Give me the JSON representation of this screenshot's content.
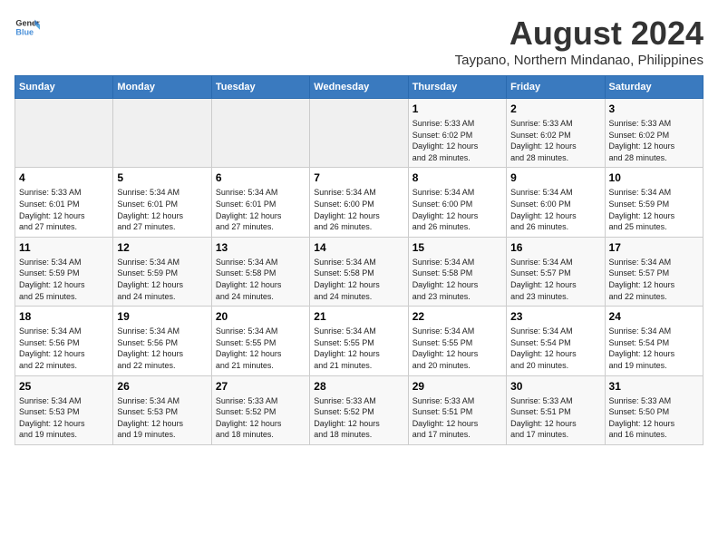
{
  "logo": {
    "general": "General",
    "blue": "Blue"
  },
  "title": "August 2024",
  "subtitle": "Taypano, Northern Mindanao, Philippines",
  "days_of_week": [
    "Sunday",
    "Monday",
    "Tuesday",
    "Wednesday",
    "Thursday",
    "Friday",
    "Saturday"
  ],
  "weeks": [
    [
      {
        "day": "",
        "info": ""
      },
      {
        "day": "",
        "info": ""
      },
      {
        "day": "",
        "info": ""
      },
      {
        "day": "",
        "info": ""
      },
      {
        "day": "1",
        "info": "Sunrise: 5:33 AM\nSunset: 6:02 PM\nDaylight: 12 hours\nand 28 minutes."
      },
      {
        "day": "2",
        "info": "Sunrise: 5:33 AM\nSunset: 6:02 PM\nDaylight: 12 hours\nand 28 minutes."
      },
      {
        "day": "3",
        "info": "Sunrise: 5:33 AM\nSunset: 6:02 PM\nDaylight: 12 hours\nand 28 minutes."
      }
    ],
    [
      {
        "day": "4",
        "info": "Sunrise: 5:33 AM\nSunset: 6:01 PM\nDaylight: 12 hours\nand 27 minutes."
      },
      {
        "day": "5",
        "info": "Sunrise: 5:34 AM\nSunset: 6:01 PM\nDaylight: 12 hours\nand 27 minutes."
      },
      {
        "day": "6",
        "info": "Sunrise: 5:34 AM\nSunset: 6:01 PM\nDaylight: 12 hours\nand 27 minutes."
      },
      {
        "day": "7",
        "info": "Sunrise: 5:34 AM\nSunset: 6:00 PM\nDaylight: 12 hours\nand 26 minutes."
      },
      {
        "day": "8",
        "info": "Sunrise: 5:34 AM\nSunset: 6:00 PM\nDaylight: 12 hours\nand 26 minutes."
      },
      {
        "day": "9",
        "info": "Sunrise: 5:34 AM\nSunset: 6:00 PM\nDaylight: 12 hours\nand 26 minutes."
      },
      {
        "day": "10",
        "info": "Sunrise: 5:34 AM\nSunset: 5:59 PM\nDaylight: 12 hours\nand 25 minutes."
      }
    ],
    [
      {
        "day": "11",
        "info": "Sunrise: 5:34 AM\nSunset: 5:59 PM\nDaylight: 12 hours\nand 25 minutes."
      },
      {
        "day": "12",
        "info": "Sunrise: 5:34 AM\nSunset: 5:59 PM\nDaylight: 12 hours\nand 24 minutes."
      },
      {
        "day": "13",
        "info": "Sunrise: 5:34 AM\nSunset: 5:58 PM\nDaylight: 12 hours\nand 24 minutes."
      },
      {
        "day": "14",
        "info": "Sunrise: 5:34 AM\nSunset: 5:58 PM\nDaylight: 12 hours\nand 24 minutes."
      },
      {
        "day": "15",
        "info": "Sunrise: 5:34 AM\nSunset: 5:58 PM\nDaylight: 12 hours\nand 23 minutes."
      },
      {
        "day": "16",
        "info": "Sunrise: 5:34 AM\nSunset: 5:57 PM\nDaylight: 12 hours\nand 23 minutes."
      },
      {
        "day": "17",
        "info": "Sunrise: 5:34 AM\nSunset: 5:57 PM\nDaylight: 12 hours\nand 22 minutes."
      }
    ],
    [
      {
        "day": "18",
        "info": "Sunrise: 5:34 AM\nSunset: 5:56 PM\nDaylight: 12 hours\nand 22 minutes."
      },
      {
        "day": "19",
        "info": "Sunrise: 5:34 AM\nSunset: 5:56 PM\nDaylight: 12 hours\nand 22 minutes."
      },
      {
        "day": "20",
        "info": "Sunrise: 5:34 AM\nSunset: 5:55 PM\nDaylight: 12 hours\nand 21 minutes."
      },
      {
        "day": "21",
        "info": "Sunrise: 5:34 AM\nSunset: 5:55 PM\nDaylight: 12 hours\nand 21 minutes."
      },
      {
        "day": "22",
        "info": "Sunrise: 5:34 AM\nSunset: 5:55 PM\nDaylight: 12 hours\nand 20 minutes."
      },
      {
        "day": "23",
        "info": "Sunrise: 5:34 AM\nSunset: 5:54 PM\nDaylight: 12 hours\nand 20 minutes."
      },
      {
        "day": "24",
        "info": "Sunrise: 5:34 AM\nSunset: 5:54 PM\nDaylight: 12 hours\nand 19 minutes."
      }
    ],
    [
      {
        "day": "25",
        "info": "Sunrise: 5:34 AM\nSunset: 5:53 PM\nDaylight: 12 hours\nand 19 minutes."
      },
      {
        "day": "26",
        "info": "Sunrise: 5:34 AM\nSunset: 5:53 PM\nDaylight: 12 hours\nand 19 minutes."
      },
      {
        "day": "27",
        "info": "Sunrise: 5:33 AM\nSunset: 5:52 PM\nDaylight: 12 hours\nand 18 minutes."
      },
      {
        "day": "28",
        "info": "Sunrise: 5:33 AM\nSunset: 5:52 PM\nDaylight: 12 hours\nand 18 minutes."
      },
      {
        "day": "29",
        "info": "Sunrise: 5:33 AM\nSunset: 5:51 PM\nDaylight: 12 hours\nand 17 minutes."
      },
      {
        "day": "30",
        "info": "Sunrise: 5:33 AM\nSunset: 5:51 PM\nDaylight: 12 hours\nand 17 minutes."
      },
      {
        "day": "31",
        "info": "Sunrise: 5:33 AM\nSunset: 5:50 PM\nDaylight: 12 hours\nand 16 minutes."
      }
    ]
  ]
}
